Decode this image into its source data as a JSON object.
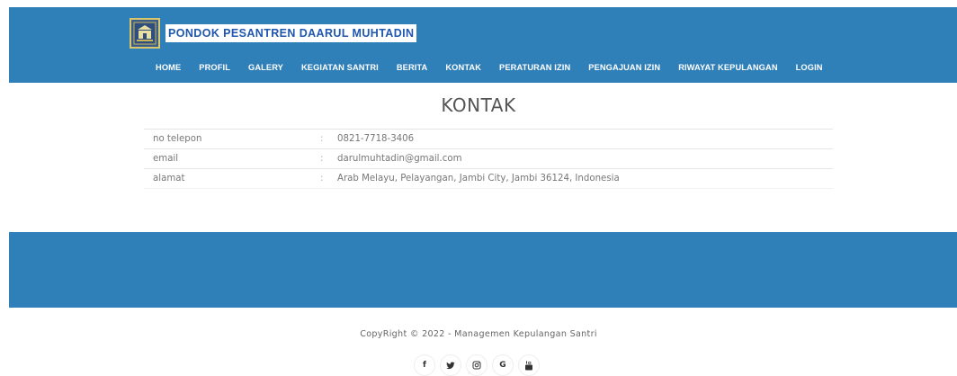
{
  "header": {
    "site_title": "PONDOK PESANTREN DAARUL MUHTADIN",
    "logo_icon": "pesantren-emblem-icon",
    "bg_color": "#2f7fb8",
    "nav": [
      {
        "label": "HOME"
      },
      {
        "label": "PROFIL"
      },
      {
        "label": "GALERY"
      },
      {
        "label": "KEGIATAN SANTRI"
      },
      {
        "label": "BERITA"
      },
      {
        "label": "KONTAK"
      },
      {
        "label": "PERATURAN IZIN"
      },
      {
        "label": "PENGAJUAN IZIN"
      },
      {
        "label": "RIWAYAT KEPULANGAN"
      },
      {
        "label": "LOGIN"
      }
    ]
  },
  "main": {
    "title": "KONTAK",
    "contacts": [
      {
        "label": "no telepon",
        "separator": ":",
        "value": "0821-7718-3406"
      },
      {
        "label": "email",
        "separator": ":",
        "value": "darulmuhtadin@gmail.com"
      },
      {
        "label": "alamat",
        "separator": ":",
        "value": "Arab Melayu, Pelayangan, Jambi City, Jambi 36124, Indonesia"
      }
    ]
  },
  "footer": {
    "copyright": "CopyRight © 2022 - Managemen Kepulangan Santri",
    "social": [
      {
        "icon": "facebook-icon",
        "glyph": "f"
      },
      {
        "icon": "twitter-icon",
        "glyph": "🐦"
      },
      {
        "icon": "instagram-icon",
        "glyph": "◎"
      },
      {
        "icon": "google-icon",
        "glyph": "G"
      },
      {
        "icon": "youtube-icon",
        "glyph": "▶"
      }
    ]
  }
}
